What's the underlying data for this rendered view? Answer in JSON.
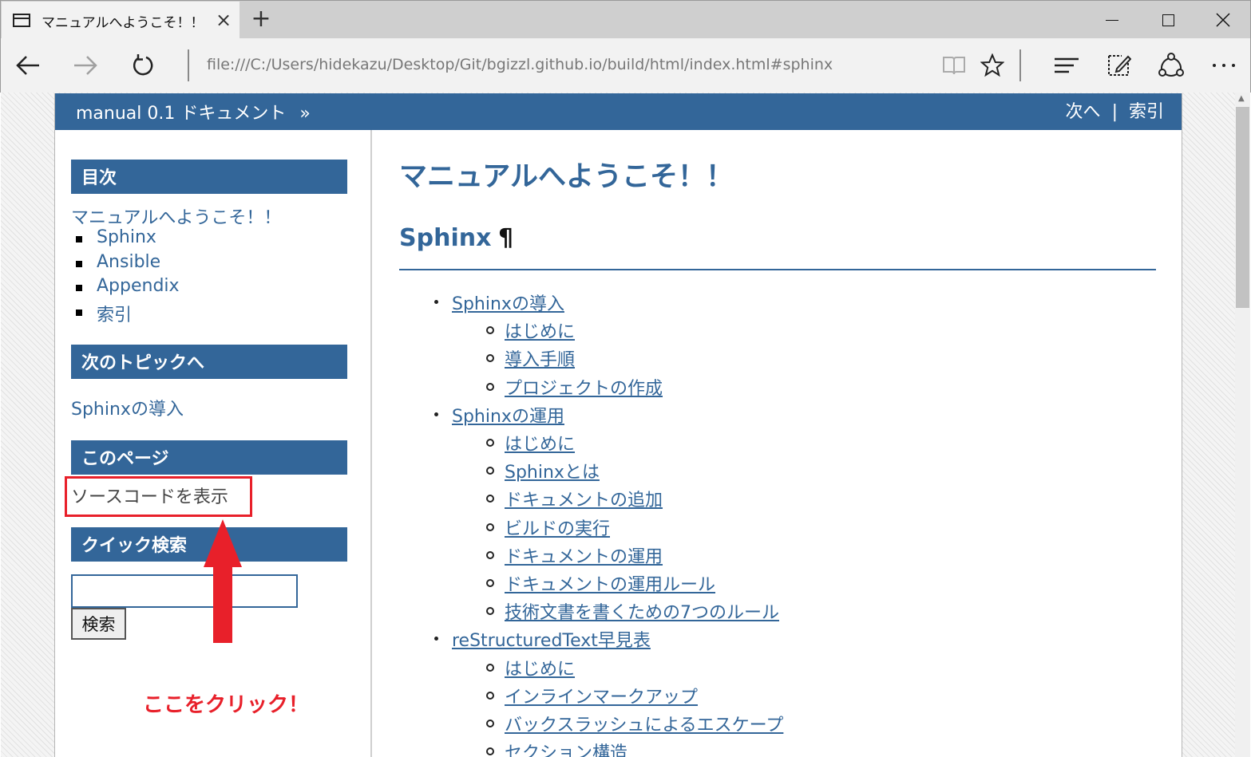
{
  "browser": {
    "tab_title": "マニュアルへようこそ！！",
    "tab_close": "×",
    "new_tab": "+",
    "url": "file:///C:/Users/hidekazu/Desktop/Git/bgizzl.github.io/build/html/index.html#sphinx"
  },
  "page": {
    "relbar": {
      "home": "manual 0.1 ドキュメント",
      "home_sep": "»",
      "next": "次へ",
      "sep": "|",
      "index": "索引"
    },
    "sidebar": {
      "toc_heading": "目次",
      "toc_root": "マニュアルへようこそ！！",
      "toc_items": [
        "Sphinx",
        "Ansible",
        "Appendix",
        "索引"
      ],
      "next_heading": "次のトピックへ",
      "next_link": "Sphinxの導入",
      "this_page_heading": "このページ",
      "show_source": "ソースコードを表示",
      "quick_search_heading": "クイック検索",
      "search_value": "",
      "search_button": "検索"
    },
    "title": "マニュアルへようこそ！！",
    "section": {
      "heading": "Sphinx",
      "pilcrow": "¶"
    },
    "toctree": [
      {
        "label": "Sphinxの導入",
        "children": [
          "はじめに",
          "導入手順",
          "プロジェクトの作成"
        ]
      },
      {
        "label": "Sphinxの運用",
        "children": [
          "はじめに",
          "Sphinxとは",
          "ドキュメントの追加",
          "ビルドの実行",
          "ドキュメントの運用",
          "ドキュメントの運用ルール",
          "技術文書を書くための7つのルール"
        ]
      },
      {
        "label": "reStructuredText早見表",
        "children": [
          "はじめに",
          "インラインマークアップ",
          "バックスラッシュによるエスケープ",
          "セクション構造"
        ]
      }
    ],
    "annotation": "ここをクリック！"
  },
  "colors": {
    "accent": "#336699",
    "annotation": "#e8202a"
  }
}
